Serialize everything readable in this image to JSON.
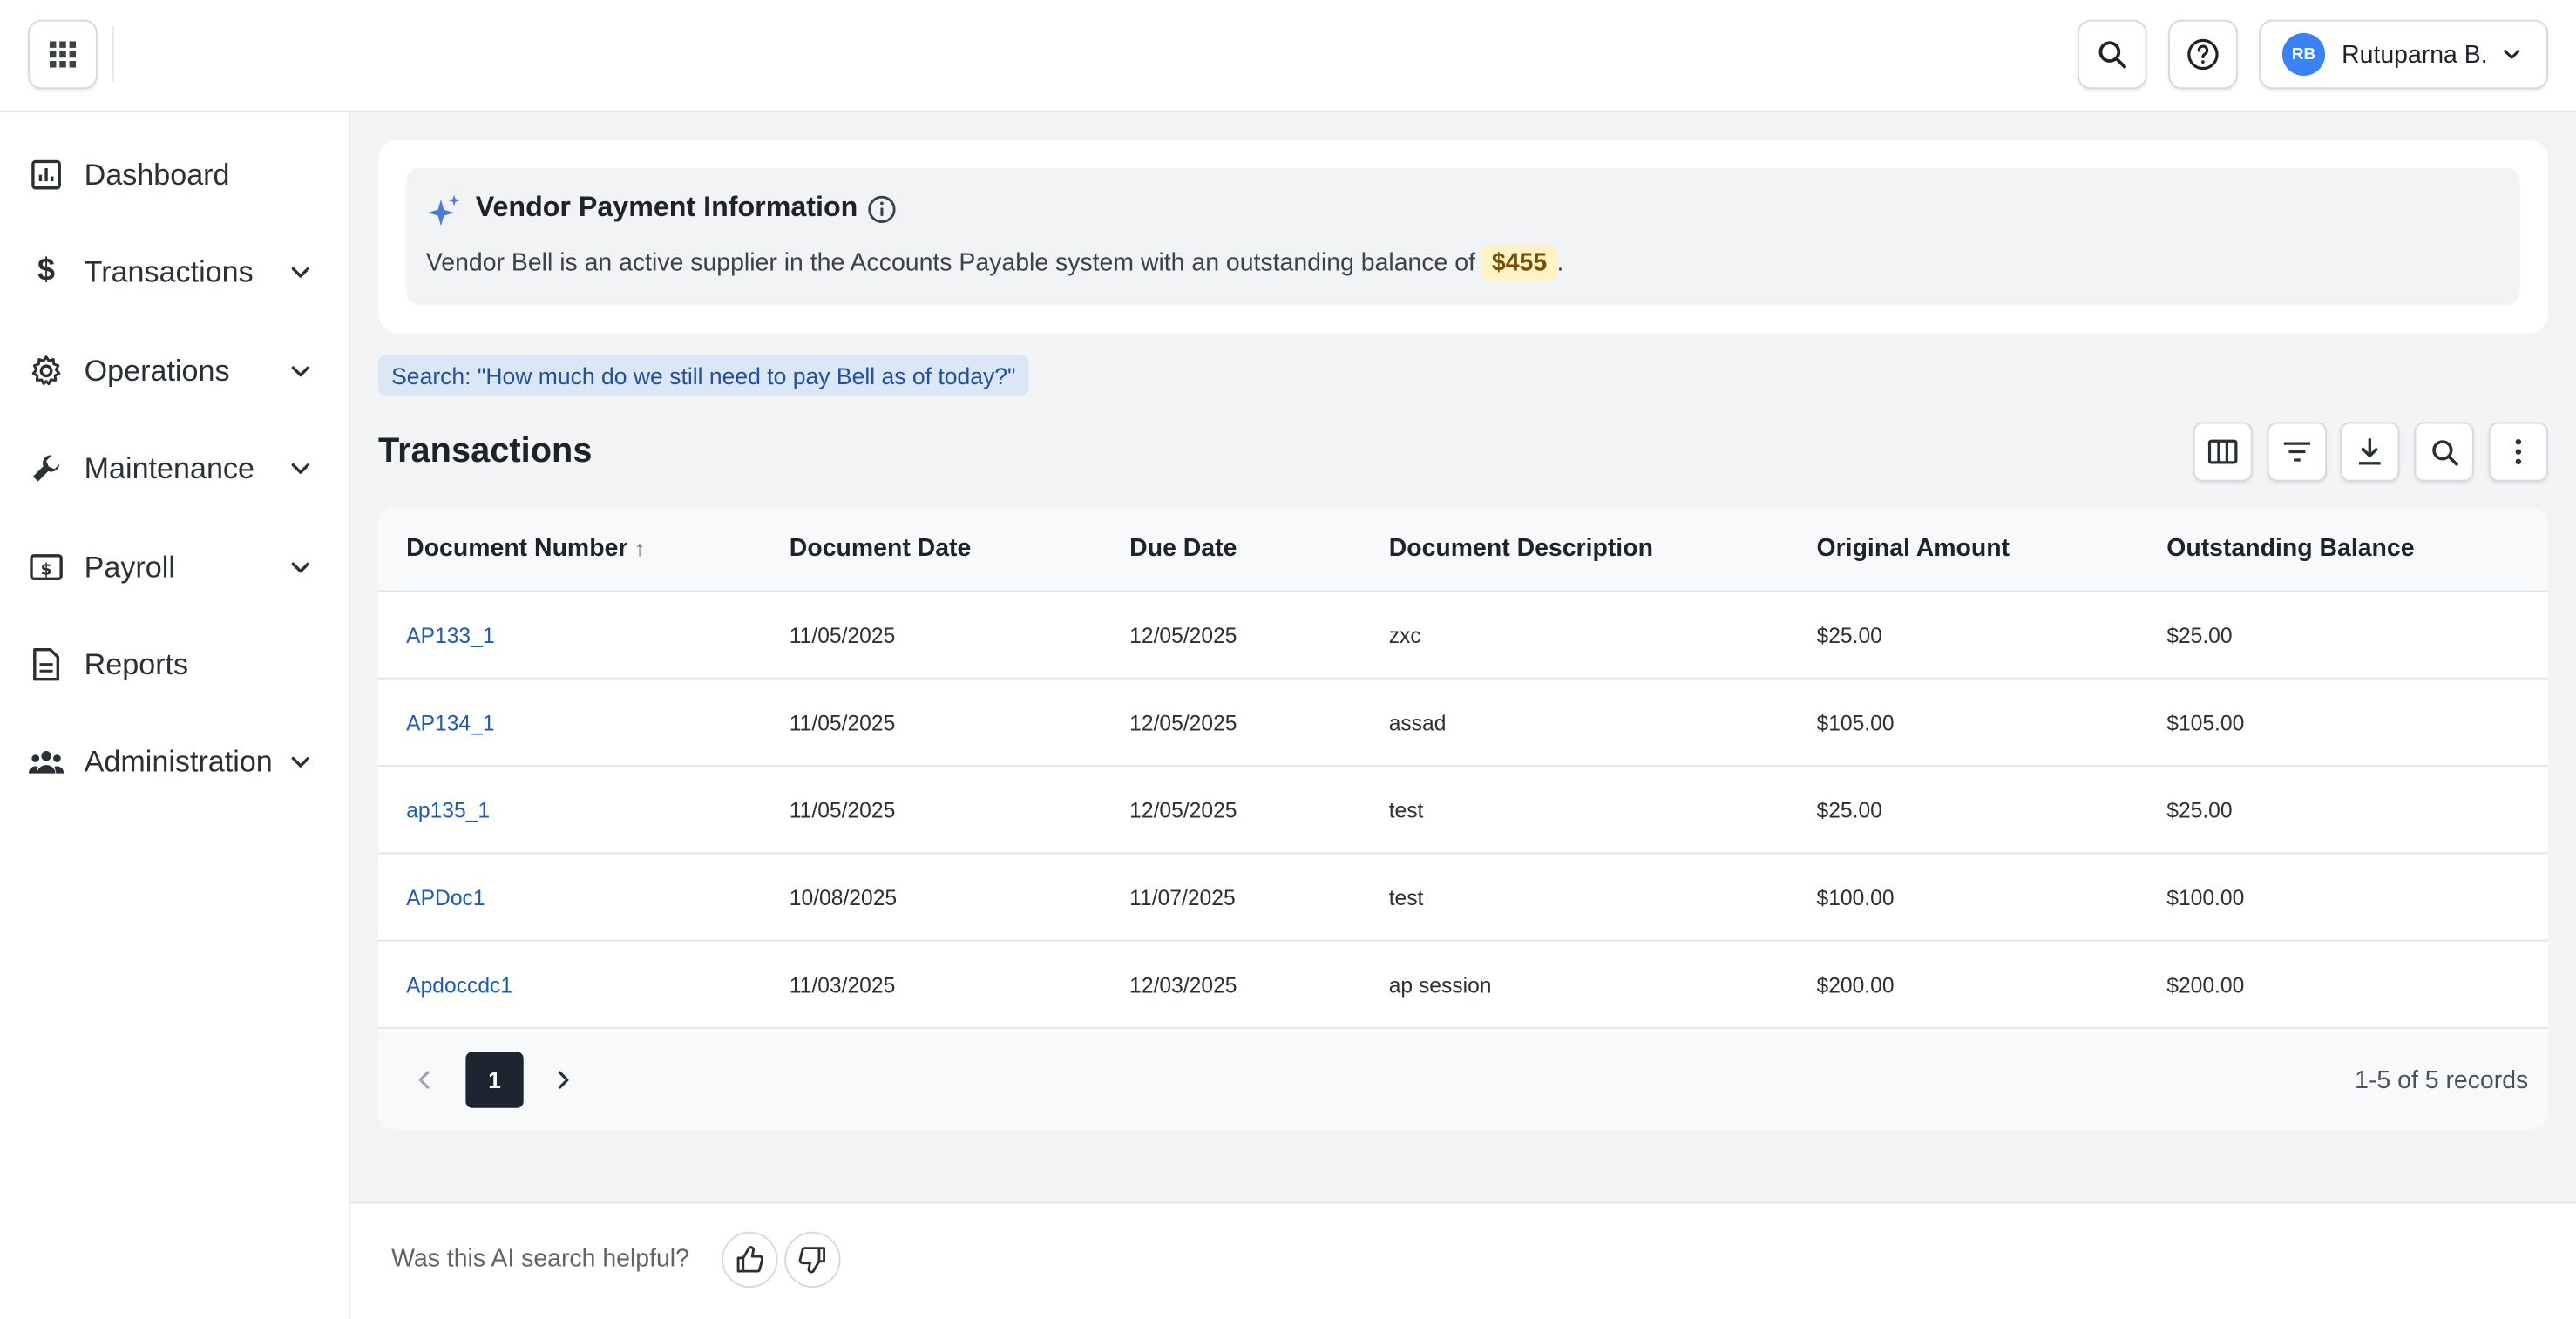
{
  "header": {
    "user_initials": "RB",
    "user_name": "Rutuparna B."
  },
  "sidebar": {
    "items": [
      {
        "label": "Dashboard",
        "icon": "dashboard-icon",
        "expandable": false
      },
      {
        "label": "Transactions",
        "icon": "dollar-icon",
        "expandable": true
      },
      {
        "label": "Operations",
        "icon": "gear-icon",
        "expandable": true
      },
      {
        "label": "Maintenance",
        "icon": "wrench-icon",
        "expandable": true
      },
      {
        "label": "Payroll",
        "icon": "payroll-icon",
        "expandable": true
      },
      {
        "label": "Reports",
        "icon": "document-icon",
        "expandable": false
      },
      {
        "label": "Administration",
        "icon": "people-icon",
        "expandable": true
      }
    ]
  },
  "ai_card": {
    "title": "Vendor Payment Information",
    "text": "Vendor Bell is an active supplier in the Accounts Payable system with an outstanding balance of",
    "amount": "$455",
    "text_end": "."
  },
  "search_query": "Search: \"How much do we still need to pay Bell as of today?\"",
  "transactions": {
    "title": "Transactions",
    "columns": [
      "Document Number",
      "Document Date",
      "Due Date",
      "Document Description",
      "Original Amount",
      "Outstanding Balance"
    ],
    "sort_indicator": "↑",
    "rows": [
      [
        "AP133_1",
        "11/05/2025",
        "12/05/2025",
        "zxc",
        "$25.00",
        "$25.00"
      ],
      [
        "AP134_1",
        "11/05/2025",
        "12/05/2025",
        "assad",
        "$105.00",
        "$105.00"
      ],
      [
        "ap135_1",
        "11/05/2025",
        "12/05/2025",
        "test",
        "$25.00",
        "$25.00"
      ],
      [
        "APDoc1",
        "10/08/2025",
        "11/07/2025",
        "test",
        "$100.00",
        "$100.00"
      ],
      [
        "Apdoccdc1",
        "11/03/2025",
        "12/03/2025",
        "ap session",
        "$200.00",
        "$200.00"
      ]
    ],
    "page": "1",
    "records": "1-5 of 5 records"
  },
  "feedback": {
    "question": "Was this AI search helpful?"
  },
  "colors": {
    "accent": "#1e5bb8",
    "avatar": "#3b82f6",
    "amount_chip": "#fdf3c4",
    "search_chip": "#dbe7f7"
  }
}
